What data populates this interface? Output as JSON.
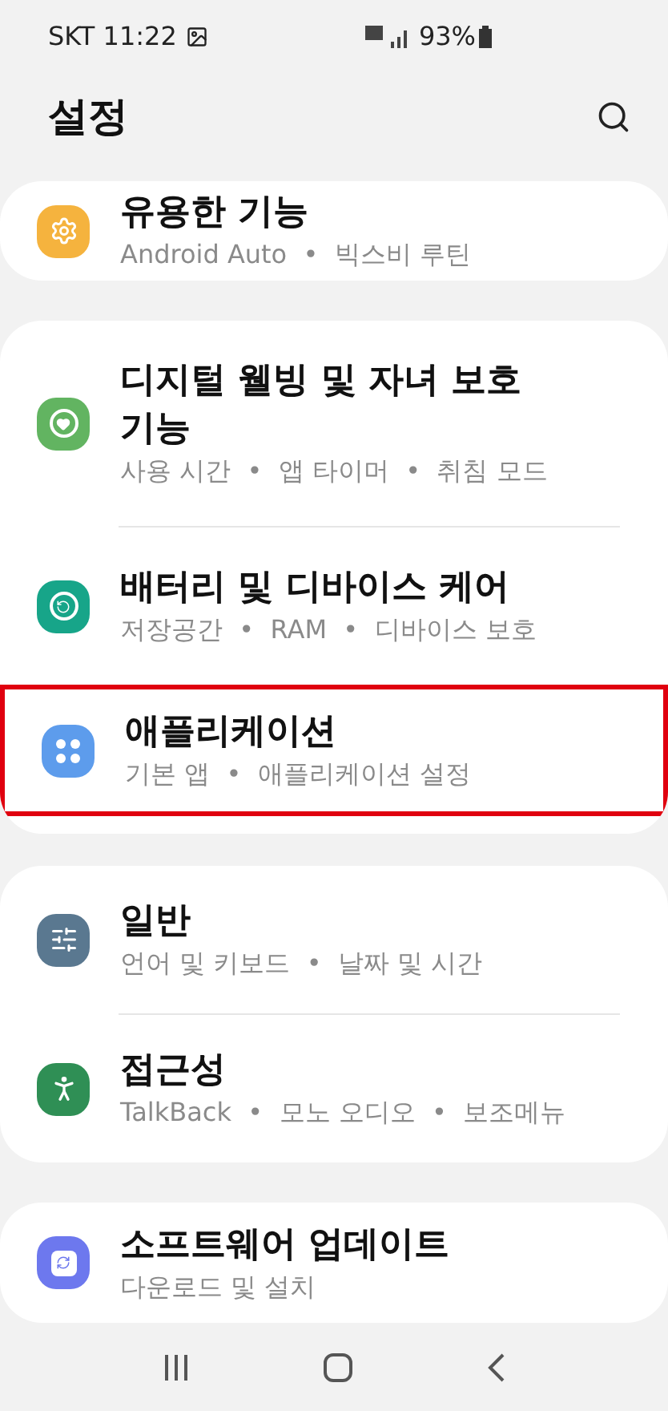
{
  "status_bar": {
    "carrier_time": "SKT 11:22",
    "battery": "93%"
  },
  "header": {
    "title": "설정"
  },
  "groups": [
    {
      "items": [
        {
          "title": "유용한 기능",
          "subtitle": "Android Auto  •  빅스비 루틴",
          "highlighted": false
        }
      ]
    },
    {
      "items": [
        {
          "title": "디지털 웰빙 및 자녀 보호 기능",
          "subtitle": "사용 시간  •  앱 타이머  •  취침 모드",
          "highlighted": false
        },
        {
          "title": "배터리 및 디바이스 케어",
          "subtitle": "저장공간  •  RAM  •  디바이스 보호",
          "highlighted": false
        },
        {
          "title": "애플리케이션",
          "subtitle": "기본 앱  •  애플리케이션 설정",
          "highlighted": true
        }
      ]
    },
    {
      "items": [
        {
          "title": "일반",
          "subtitle": "언어 및 키보드  •  날짜 및 시간",
          "highlighted": false
        },
        {
          "title": "접근성",
          "subtitle": "TalkBack  •  모노 오디오  •  보조메뉴",
          "highlighted": false
        }
      ]
    },
    {
      "items": [
        {
          "title": "소프트웨어 업데이트",
          "subtitle": "다운로드 및 설치",
          "highlighted": false
        }
      ]
    }
  ]
}
